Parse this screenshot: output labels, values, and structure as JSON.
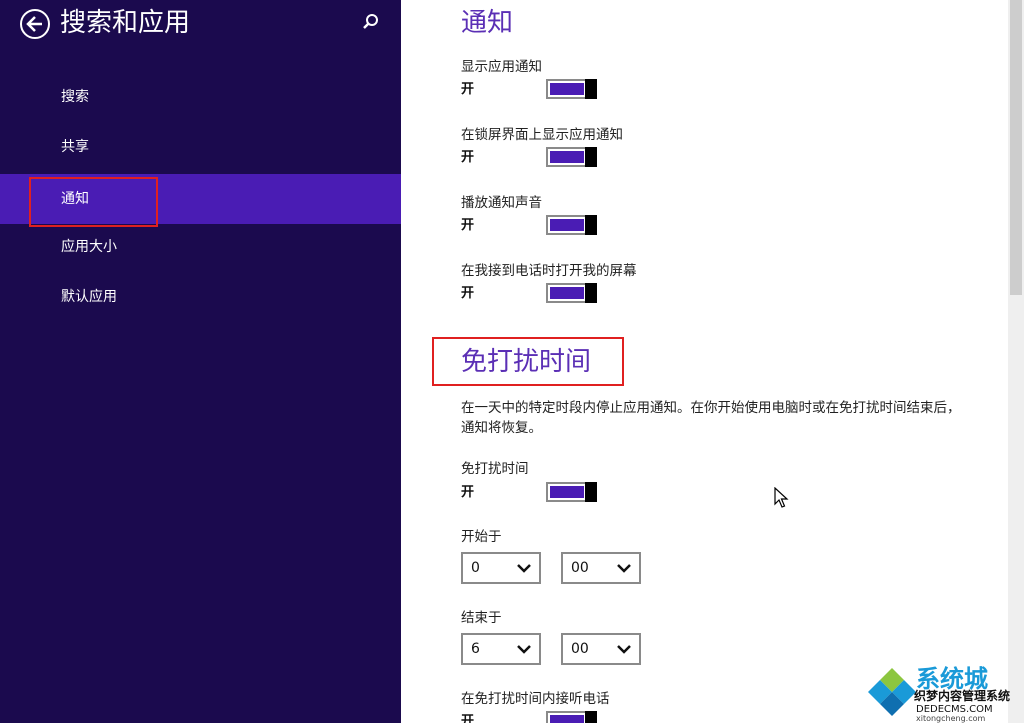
{
  "sidebar": {
    "title": "搜索和应用",
    "items": [
      {
        "label": "搜索"
      },
      {
        "label": "共享"
      },
      {
        "label": "通知"
      },
      {
        "label": "应用大小"
      },
      {
        "label": "默认应用"
      }
    ],
    "active_index": 2
  },
  "notifications": {
    "heading": "通知",
    "settings": [
      {
        "label": "显示应用通知",
        "state": "开"
      },
      {
        "label": "在锁屏界面上显示应用通知",
        "state": "开"
      },
      {
        "label": "播放通知声音",
        "state": "开"
      },
      {
        "label": "在我接到电话时打开我的屏幕",
        "state": "开"
      }
    ]
  },
  "quiet_hours": {
    "heading": "免打扰时间",
    "description": "在一天中的特定时段内停止应用通知。在你开始使用电脑时或在免打扰时间结束后，通知将恢复。",
    "toggle": {
      "label": "免打扰时间",
      "state": "开"
    },
    "start": {
      "label": "开始于",
      "hour": "0",
      "minute": "00"
    },
    "end": {
      "label": "结束于",
      "hour": "6",
      "minute": "00"
    },
    "calls": {
      "label": "在免打扰时间内接听电话",
      "state": "开"
    }
  },
  "watermark": {
    "name": "系统城",
    "sub": "织梦内容管理系统",
    "url": "DEDECMS.COM",
    "url2": "xitongcheng.com"
  },
  "colors": {
    "sidebar_bg": "#1b0a4e",
    "accent": "#4a1cb4",
    "heading": "#5b2fb5",
    "highlight_box": "#e02020"
  }
}
